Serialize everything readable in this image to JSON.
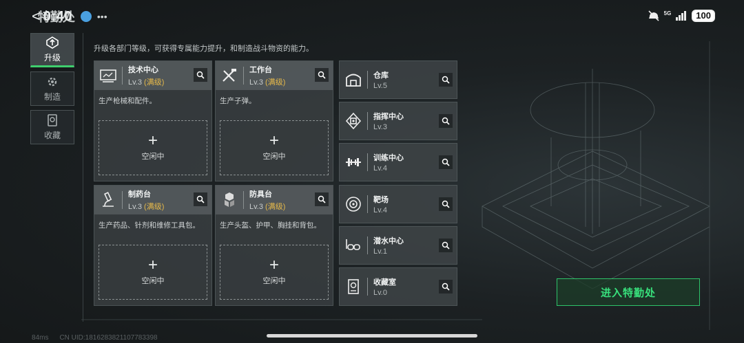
{
  "status": {
    "time": "0:40",
    "title": "特勤处",
    "network": "5G",
    "battery": "100"
  },
  "nav": [
    {
      "label": "升级",
      "icon": "upgrade-icon",
      "active": true
    },
    {
      "label": "制造",
      "icon": "gear-icon",
      "active": false
    },
    {
      "label": "收藏",
      "icon": "collection-icon",
      "active": false
    }
  ],
  "description": "升级各部门等级，可获得专属能力提升，和制造战斗物资的能力。",
  "big_cards": [
    {
      "title": "技术中心",
      "level": "Lv.3",
      "max": "(满级)",
      "desc": "生产枪械和配件。",
      "slot": "空闲中",
      "icon": "computer-icon"
    },
    {
      "title": "工作台",
      "level": "Lv.3",
      "max": "(满级)",
      "desc": "生产子弹。",
      "slot": "空闲中",
      "icon": "tools-icon"
    },
    {
      "title": "制药台",
      "level": "Lv.3",
      "max": "(满级)",
      "desc": "生产药品、针剂和维修工具包。",
      "slot": "空闲中",
      "icon": "microscope-icon"
    },
    {
      "title": "防具台",
      "level": "Lv.3",
      "max": "(满级)",
      "desc": "生产头盔、护甲、胸挂和背包。",
      "slot": "空闲中",
      "icon": "armor-icon"
    }
  ],
  "mini_cards": [
    {
      "title": "仓库",
      "level": "Lv.5",
      "icon": "warehouse-icon"
    },
    {
      "title": "指挥中心",
      "level": "Lv.3",
      "icon": "command-icon"
    },
    {
      "title": "训练中心",
      "level": "Lv.4",
      "icon": "dumbbell-icon"
    },
    {
      "title": "靶场",
      "level": "Lv.4",
      "icon": "target-icon"
    },
    {
      "title": "潜水中心",
      "level": "Lv.1",
      "icon": "diving-icon"
    },
    {
      "title": "收藏室",
      "level": "Lv.0",
      "icon": "vault-icon"
    }
  ],
  "enter_button": "进入特勤处",
  "footer": {
    "ping": "84ms",
    "uid": "CN UID:1816283821107783398"
  }
}
